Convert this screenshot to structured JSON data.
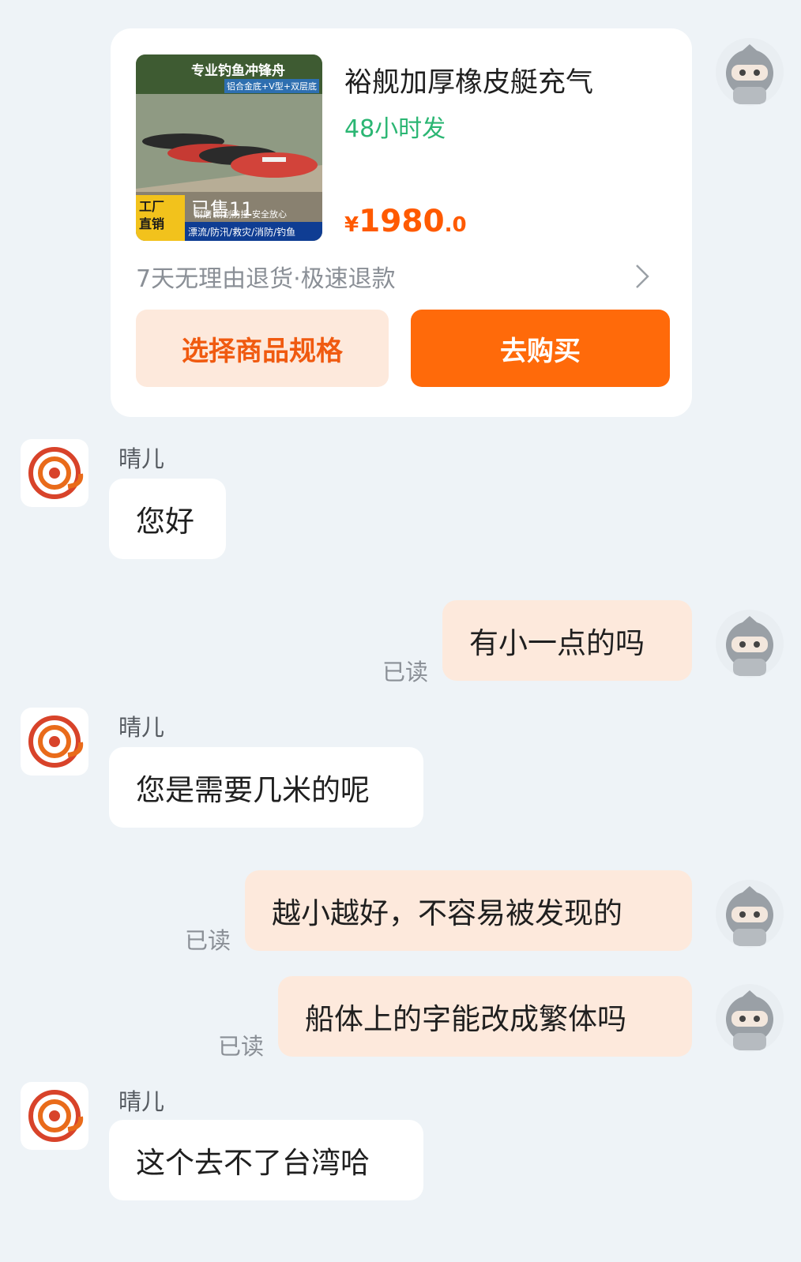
{
  "product": {
    "title": "裕舰加厚橡皮艇充气",
    "shipping": "48小时发",
    "price_currency": "¥",
    "price_int": "1980",
    "price_dec": ".0",
    "guarantee": "7天无理由退货·极速退款",
    "spec_button": "选择商品规格",
    "buy_button": "去购买",
    "image": {
      "headline": "专业钓鱼冲锋舟",
      "subline": "铝合金底+V型+双层底",
      "badge": "工厂\n直销",
      "sold": "已售11",
      "tags_top": "耐磨 耐刮防撞 安全放心",
      "tags_bottom": "漂流/防汛/救灾/消防/钓鱼"
    }
  },
  "seller_name": "晴儿",
  "read_label": "已读",
  "messages": [
    {
      "side": "in",
      "text": "您好"
    },
    {
      "side": "out",
      "text": "有小一点的吗"
    },
    {
      "side": "in",
      "text": "您是需要几米的呢"
    },
    {
      "side": "out",
      "text": "越小越好，不容易被发现的"
    },
    {
      "side": "out",
      "text": "船体上的字能改成繁体吗"
    },
    {
      "side": "in",
      "text": "这个去不了台湾哈"
    }
  ],
  "colors": {
    "accent": "#ff6a0a",
    "shipping": "#2bb673",
    "price": "#ff5a00",
    "out_bubble": "#fde9dc",
    "background": "#eef3f7"
  }
}
